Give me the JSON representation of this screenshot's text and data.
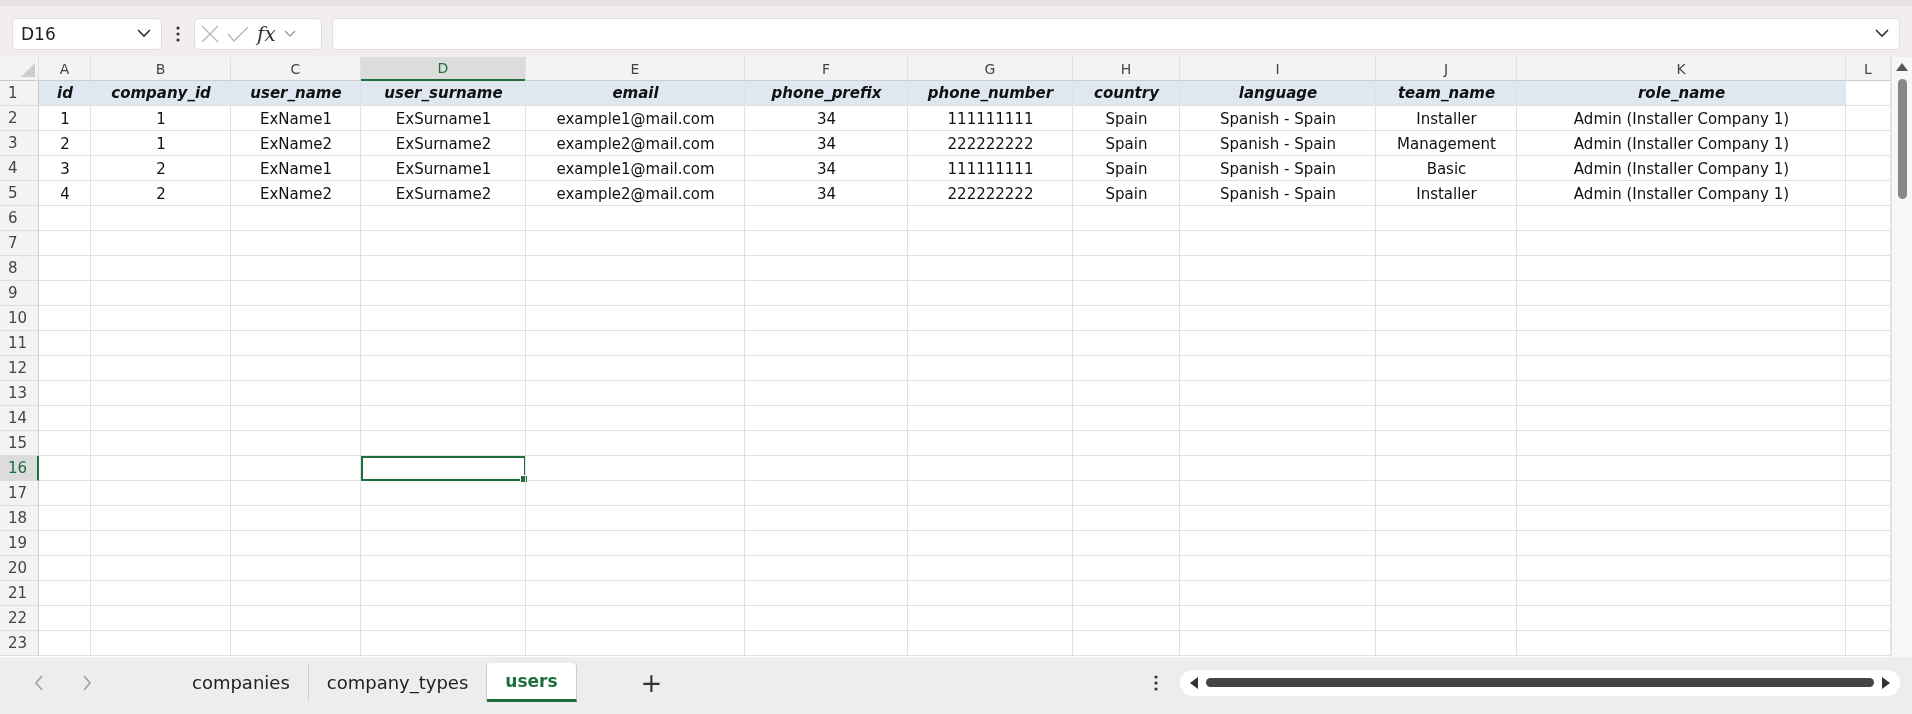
{
  "name_box": {
    "value": "D16"
  },
  "formula_bar": {
    "fx": "fx"
  },
  "grid": {
    "columns": [
      {
        "letter": "A",
        "selected": false
      },
      {
        "letter": "B",
        "selected": false
      },
      {
        "letter": "C",
        "selected": false
      },
      {
        "letter": "D",
        "selected": true
      },
      {
        "letter": "E",
        "selected": false
      },
      {
        "letter": "F",
        "selected": false
      },
      {
        "letter": "G",
        "selected": false
      },
      {
        "letter": "H",
        "selected": false
      },
      {
        "letter": "I",
        "selected": false
      },
      {
        "letter": "J",
        "selected": false
      },
      {
        "letter": "K",
        "selected": false
      },
      {
        "letter": "L",
        "selected": false
      }
    ],
    "rows": [
      {
        "number": "1",
        "kind": "header",
        "selected": false,
        "cells": [
          "id",
          "company_id",
          "user_name",
          "user_surname",
          "email",
          "phone_prefix",
          "phone_number",
          "country",
          "language",
          "team_name",
          "role_name"
        ]
      },
      {
        "number": "2",
        "kind": "data",
        "selected": false,
        "cells": [
          "1",
          "1",
          "ExName1",
          "ExSurname1",
          "example1@mail.com",
          "34",
          "111111111",
          "Spain",
          "Spanish - Spain",
          "Installer",
          "Admin (Installer Company 1)"
        ]
      },
      {
        "number": "3",
        "kind": "data",
        "selected": false,
        "cells": [
          "2",
          "1",
          "ExName2",
          "ExSurname2",
          "example2@mail.com",
          "34",
          "222222222",
          "Spain",
          "Spanish - Spain",
          "Management",
          "Admin (Installer Company 1)"
        ]
      },
      {
        "number": "4",
        "kind": "data",
        "selected": false,
        "cells": [
          "3",
          "2",
          "ExName1",
          "ExSurname1",
          "example1@mail.com",
          "34",
          "111111111",
          "Spain",
          "Spanish - Spain",
          "Basic",
          "Admin (Installer Company 1)"
        ]
      },
      {
        "number": "5",
        "kind": "data",
        "selected": false,
        "cells": [
          "4",
          "2",
          "ExName2",
          "ExSurname2",
          "example2@mail.com",
          "34",
          "222222222",
          "Spain",
          "Spanish - Spain",
          "Installer",
          "Admin (Installer Company 1)"
        ]
      },
      {
        "number": "6",
        "kind": "data",
        "selected": false
      },
      {
        "number": "7",
        "kind": "data",
        "selected": false
      },
      {
        "number": "8",
        "kind": "data",
        "selected": false
      },
      {
        "number": "9",
        "kind": "data",
        "selected": false
      },
      {
        "number": "10",
        "kind": "data",
        "selected": false
      },
      {
        "number": "11",
        "kind": "data",
        "selected": false
      },
      {
        "number": "12",
        "kind": "data",
        "selected": false
      },
      {
        "number": "13",
        "kind": "data",
        "selected": false
      },
      {
        "number": "14",
        "kind": "data",
        "selected": false
      },
      {
        "number": "15",
        "kind": "data",
        "selected": false
      },
      {
        "number": "16",
        "kind": "data",
        "selected": true
      },
      {
        "number": "17",
        "kind": "data",
        "selected": false
      },
      {
        "number": "18",
        "kind": "data",
        "selected": false
      },
      {
        "number": "19",
        "kind": "data",
        "selected": false
      },
      {
        "number": "20",
        "kind": "data",
        "selected": false
      },
      {
        "number": "21",
        "kind": "data",
        "selected": false
      },
      {
        "number": "22",
        "kind": "data",
        "selected": false
      },
      {
        "number": "23",
        "kind": "data",
        "selected": false
      }
    ]
  },
  "sheet_tabs": [
    {
      "label": "companies",
      "selected": false
    },
    {
      "label": "company_types",
      "selected": false
    },
    {
      "label": "users",
      "selected": true
    }
  ],
  "add_sheet": "+"
}
